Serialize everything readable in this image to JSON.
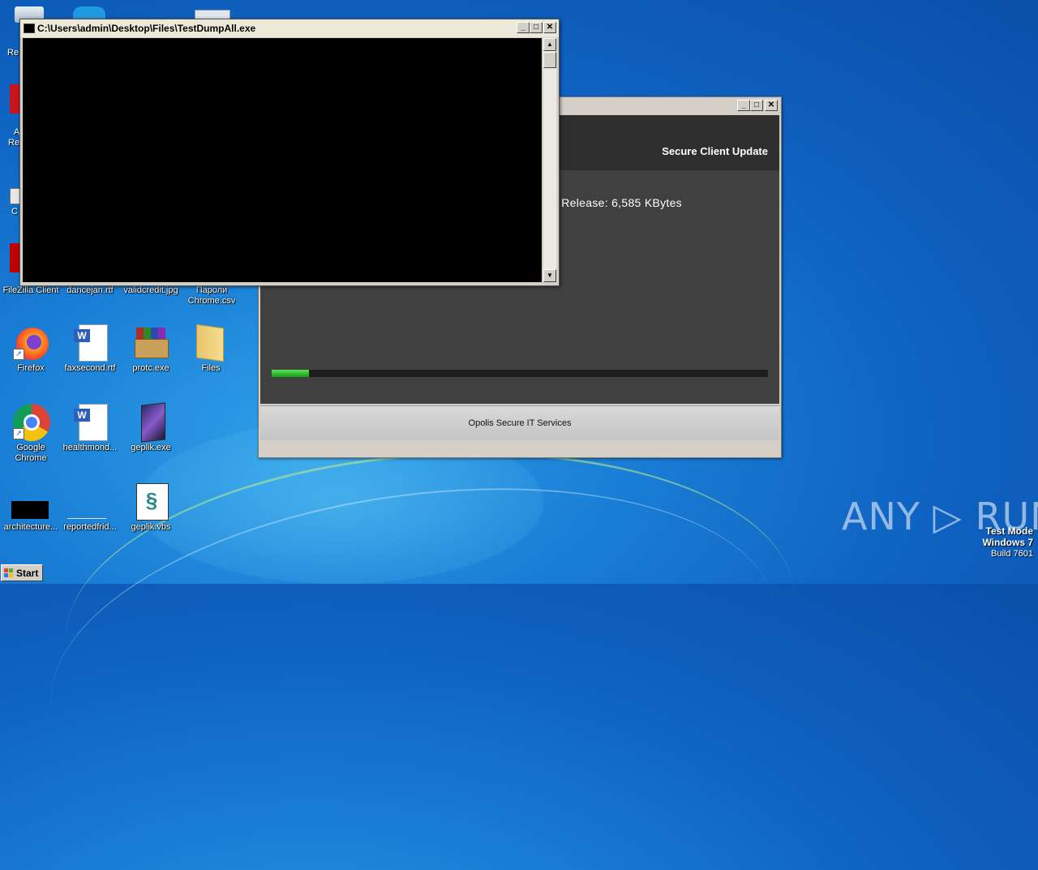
{
  "console_window": {
    "title": "C:\\Users\\admin\\Desktop\\Files\\TestDumpAll.exe",
    "buttons": {
      "minimize": "_",
      "maximize": "□",
      "close": "✕"
    }
  },
  "update_window": {
    "header_title": "Secure Client Update",
    "release_text": "test Release: 6,585 KBytes",
    "progress_fraction": 0.075,
    "footer_text": "Opolis Secure IT Services",
    "buttons": {
      "minimize": "_",
      "maximize": "□",
      "close": "✕"
    }
  },
  "desktop_icons": [
    {
      "label": "FileZilla Client"
    },
    {
      "label": "dancejan.rtf"
    },
    {
      "label": "validcredit.jpg"
    },
    {
      "label": "Пароли Chrome.csv"
    },
    {
      "label": "Firefox"
    },
    {
      "label": "faxsecond.rtf"
    },
    {
      "label": "protc.exe"
    },
    {
      "label": "Files"
    },
    {
      "label": "Google Chrome"
    },
    {
      "label": "healthmond..."
    },
    {
      "label": "geplik.exe"
    },
    {
      "label": "architecture..."
    },
    {
      "label": "reportedfrid..."
    },
    {
      "label": "geplik.vbs"
    }
  ],
  "partial_labels": {
    "re1": "Re",
    "a": "A",
    "re2": "Re",
    "c": "C"
  },
  "taskbar": {
    "start_label": "Start"
  },
  "watermark": {
    "text": "ANY ▷ RUN"
  },
  "system_info": {
    "line1": "Test Mode",
    "line2": "Windows 7",
    "line3": "Build 7601"
  },
  "colors": {
    "progress": "#22b022",
    "console_bg": "#000000",
    "update_bg": "#404040"
  }
}
